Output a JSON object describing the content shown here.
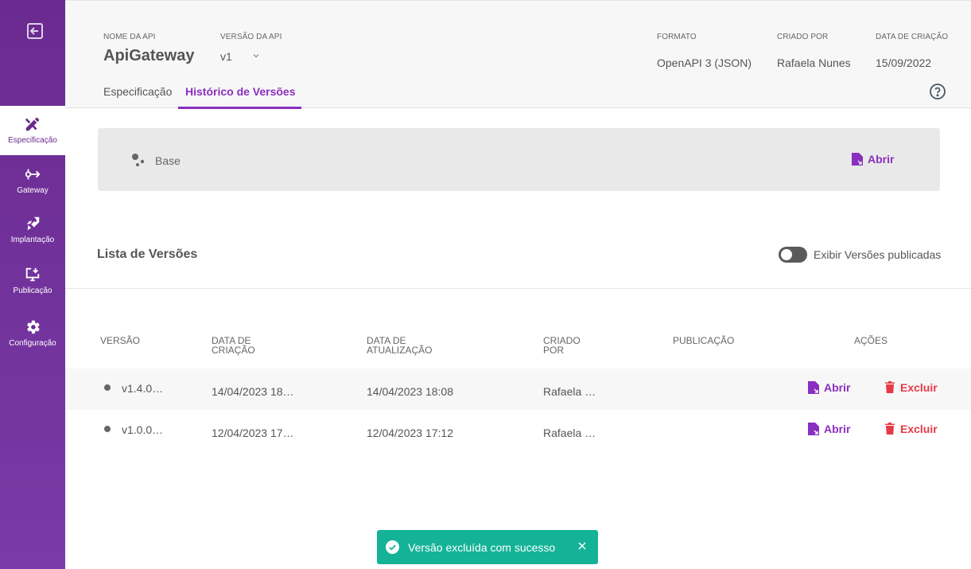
{
  "sidebar": {
    "exit_icon": "exit-icon",
    "items": [
      {
        "label": "Especificação",
        "icon": "pencil-ruler-icon",
        "active": true
      },
      {
        "label": "Gateway",
        "icon": "gateway-icon",
        "active": false
      },
      {
        "label": "Implantação",
        "icon": "rocket-icon",
        "active": false
      },
      {
        "label": "Publicação",
        "icon": "monitor-download-icon",
        "active": false
      },
      {
        "label": "Configuração",
        "icon": "gear-icon",
        "active": false
      }
    ]
  },
  "header": {
    "api_name_label": "NOME DA API",
    "api_name": "ApiGateway",
    "api_version_label": "VERSÃO DA API",
    "api_version": "v1",
    "format_label": "FORMATO",
    "format": "OpenAPI 3 (JSON)",
    "created_by_label": "CRIADO POR",
    "created_by": "Rafaela Nunes",
    "created_at_label": "DATA DE CRIAÇÃO",
    "created_at": "15/09/2022",
    "tabs": [
      {
        "label": "Especificação",
        "active": false
      },
      {
        "label": "Histórico de Versões",
        "active": true
      }
    ]
  },
  "base": {
    "label": "Base",
    "open_label": "Abrir"
  },
  "versions": {
    "title": "Lista de Versões",
    "toggle_label": "Exibir Versões publicadas",
    "toggle_on": false,
    "columns": {
      "version": "VERSÃO",
      "created": "DATA DE CRIAÇÃO",
      "updated": "DATA DE ATUALIZAÇÃO",
      "created_by": "CRIADO POR",
      "publication": "PUBLICAÇÃO",
      "actions": "AÇÕES"
    },
    "rows": [
      {
        "version": "v1.4.0…",
        "created": "14/04/2023 18…",
        "updated": "14/04/2023 18:08",
        "created_by": "Rafaela …",
        "publication": "",
        "open": "Abrir",
        "delete": "Excluir"
      },
      {
        "version": "v1.0.0…",
        "created": "12/04/2023 17…",
        "updated": "12/04/2023 17:12",
        "created_by": "Rafaela …",
        "publication": "",
        "open": "Abrir",
        "delete": "Excluir"
      }
    ]
  },
  "toast": {
    "message": "Versão excluída com sucesso"
  },
  "colors": {
    "accent": "#8a2fbf",
    "sidebar": "#6a2a8f",
    "danger": "#e53947",
    "success": "#14b398"
  }
}
